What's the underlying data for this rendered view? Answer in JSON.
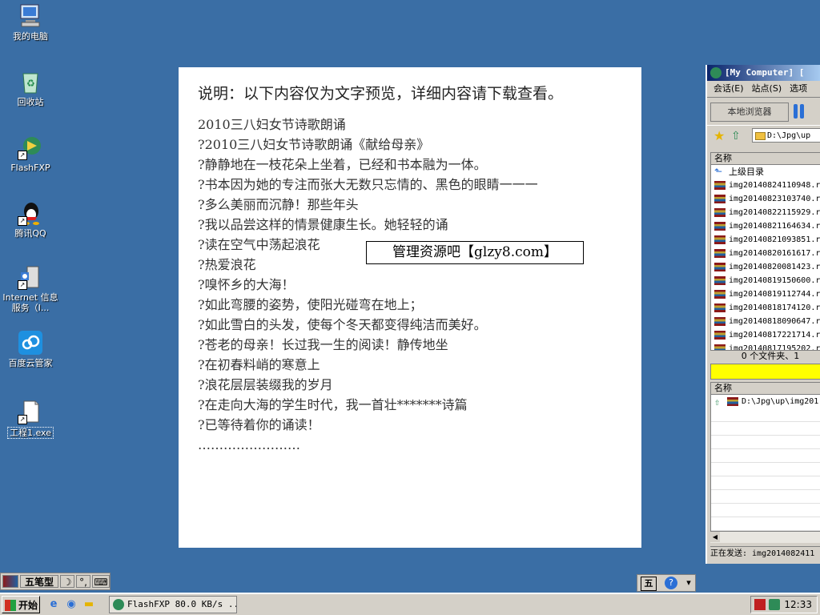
{
  "desktop": {
    "icons": [
      {
        "label": "我的电脑",
        "icon": "computer-icon"
      },
      {
        "label": "回收站",
        "icon": "recycle-bin-icon"
      },
      {
        "label": "FlashFXP",
        "icon": "flashfxp-icon"
      },
      {
        "label": "腾讯QQ",
        "icon": "qq-icon"
      },
      {
        "label": "Internet 信息服务（I...",
        "icon": "iis-icon"
      },
      {
        "label": "百度云管家",
        "icon": "baidu-cloud-icon"
      },
      {
        "label": "工程1.exe",
        "icon": "exe-file-icon"
      }
    ]
  },
  "document": {
    "heading": "说明：以下内容仅为文字预览，详细内容请下载查看。",
    "lines": [
      "2010三八妇女节诗歌朗诵",
      "?2010三八妇女节诗歌朗诵《献给母亲》",
      "?静静地在一枝花朵上坐着，已经和书本融为一体。",
      "?书本因为她的专注而张大无数只忘情的、黑色的眼睛一一一",
      "?多么美丽而沉静！那些年头",
      "?我以品尝这样的情景健康生长。她轻轻的诵",
      "?读在空气中荡起浪花",
      "?热爱浪花",
      "?嗅怀乡的大海！",
      "?如此弯腰的姿势，使阳光碰弯在地上；",
      "?如此雪白的头发，使每个冬天都变得纯洁而美好。",
      "?苍老的母亲！长过我一生的阅读！静传地坐",
      "?在初春料峭的寒意上",
      "?浪花层层装缀我的岁月",
      "?在走向大海的学生时代，我一首壮*******诗篇",
      "?已等待着你的诵读！",
      "……………………"
    ],
    "watermark": "管理资源吧【glzy8.com】"
  },
  "flashfxp": {
    "title": "[My Computer]  [",
    "menu": [
      "会话(E)",
      "站点(S)",
      "选项"
    ],
    "browse_button": "本地浏览器",
    "path": "D:\\Jpg\\up",
    "list_header": "名称",
    "parent_dir": "上级目录",
    "files": [
      "img20140824110948.r",
      "img20140823103740.r",
      "img20140822115929.r",
      "img20140821164634.r",
      "img20140821093851.r",
      "img20140820161617.r",
      "img20140820081423.r",
      "img20140819150600.r",
      "img20140819112744.r",
      "img20140818174120.r",
      "img20140818090647.r",
      "img20140817221714.r",
      "img20140817195202.r"
    ],
    "status": "0 个文件夹、1",
    "queue_header": "名称",
    "queue_item": "D:\\Jpg\\up\\img201",
    "send_status": "正在发送: img2014082411"
  },
  "ime": {
    "mode": "五笔型",
    "wubi_icon_label": "五"
  },
  "taskbar": {
    "start_label": "开始",
    "task_label": "FlashFXP 80.0 KB/s ...",
    "clock": "12:33"
  }
}
